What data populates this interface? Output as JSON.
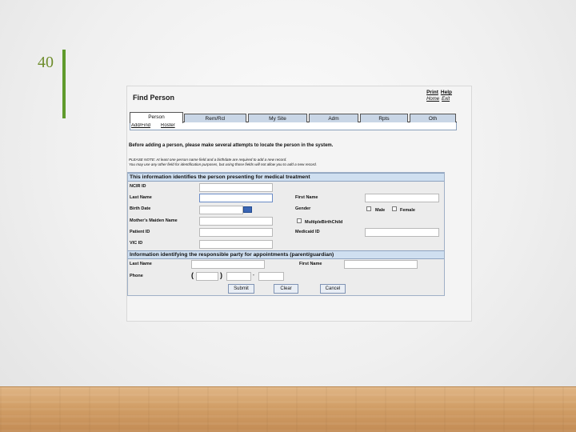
{
  "slide": {
    "number": "40"
  },
  "page": {
    "title": "Find Person",
    "top_links": {
      "print": "Print",
      "help": "Help",
      "home": "Home",
      "exit": "Exit"
    }
  },
  "tabs": [
    {
      "label": "Person",
      "active": true
    },
    {
      "label": "Rem/Rcl",
      "active": false
    },
    {
      "label": "My Site",
      "active": false
    },
    {
      "label": "Adm",
      "active": false
    },
    {
      "label": "Rpts",
      "active": false
    },
    {
      "label": "Oth",
      "active": false
    }
  ],
  "subtabs": {
    "add_find": "Add/Find",
    "roster": "Roster"
  },
  "intro": "Before adding a person, please make several attempts to locate the person in the system.",
  "note": {
    "line1": "PLEASE NOTE:  At least one person name field and a birthdate are required to add a new record.",
    "line2": "You may use any other field for identification purposes, but using those fields will not allow you to add a new record."
  },
  "section1": {
    "heading": "This information identifies the person presenting for medical treatment",
    "ncir_id": "NCIR ID",
    "last_name": "Last Name",
    "first_name": "First Name",
    "birth_date": "Birth Date",
    "gender": "Gender",
    "male": "Male",
    "female": "Female",
    "maiden_name": "Mother's Maiden Name",
    "multiple_birth": "MultipleBirthChild",
    "patient_id": "Patient ID",
    "medicaid_id": "Medicaid ID",
    "vic_id": "VIC ID"
  },
  "section2": {
    "heading": "Information identifying the responsible party for appointments (parent/guardian)",
    "last_name": "Last Name",
    "first_name": "First Name",
    "phone": "Phone",
    "open_paren": "(",
    "close_paren": ")",
    "dash": "-"
  },
  "buttons": {
    "submit": "Submit",
    "clear": "Clear",
    "cancel": "Cancel"
  },
  "colors": {
    "accent": "#5f9a2c",
    "tab": "#c9d6e6",
    "section": "#cfdff0"
  }
}
